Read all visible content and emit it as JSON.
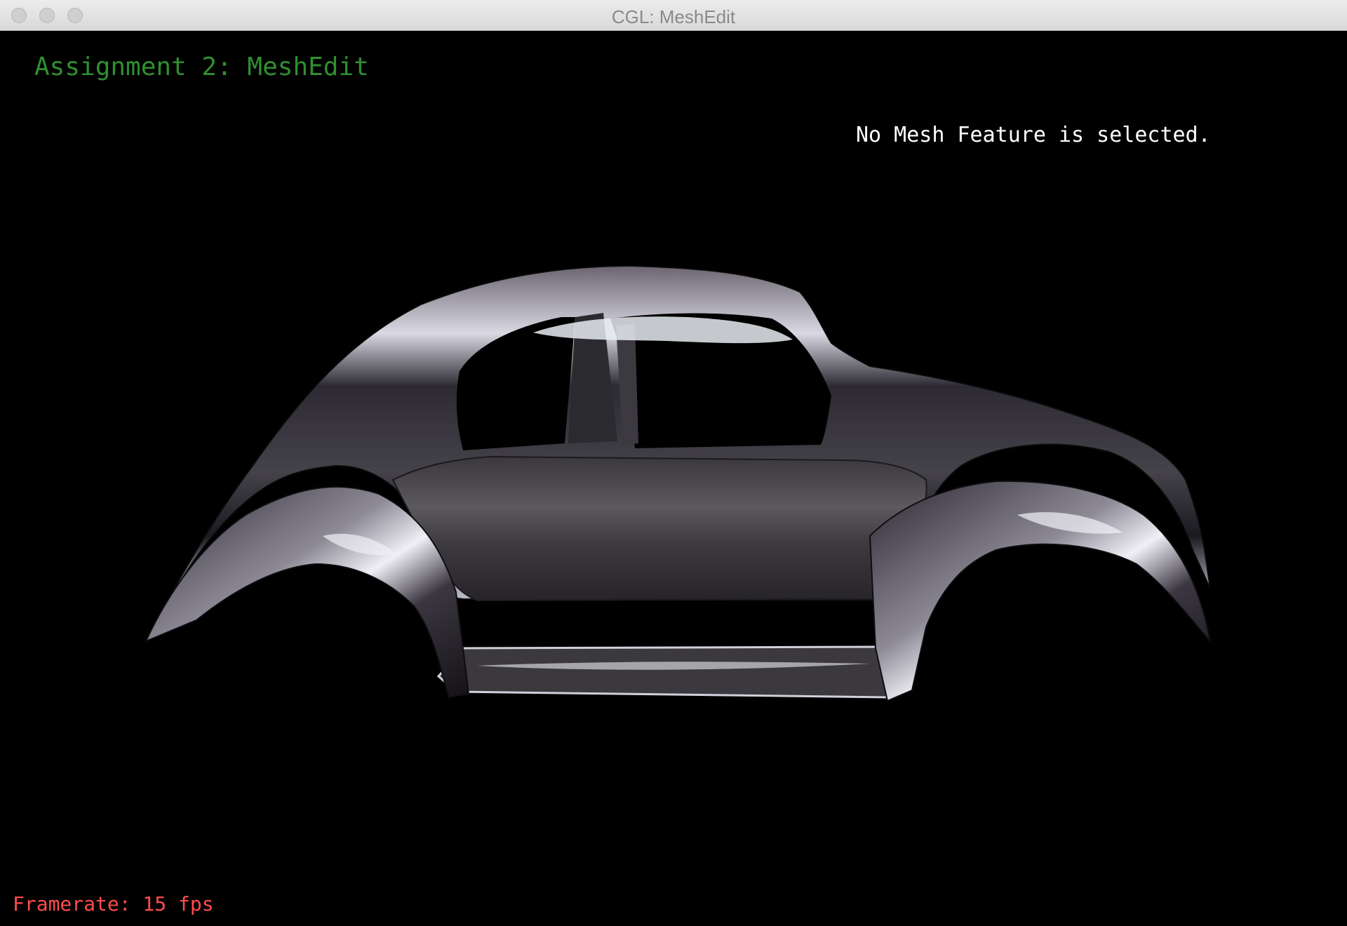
{
  "window": {
    "title": "CGL: MeshEdit"
  },
  "viewport": {
    "assignment_title": "Assignment 2: MeshEdit",
    "selection_status": "No Mesh Feature is selected.",
    "framerate": "Framerate: 15 fps"
  },
  "mesh": {
    "shape": "car-body",
    "material": "chrome-environment-map"
  },
  "colors": {
    "background": "#000000",
    "title_green": "#2f8f2f",
    "framerate_red": "#ff4d4d",
    "status_white": "#ffffff"
  }
}
